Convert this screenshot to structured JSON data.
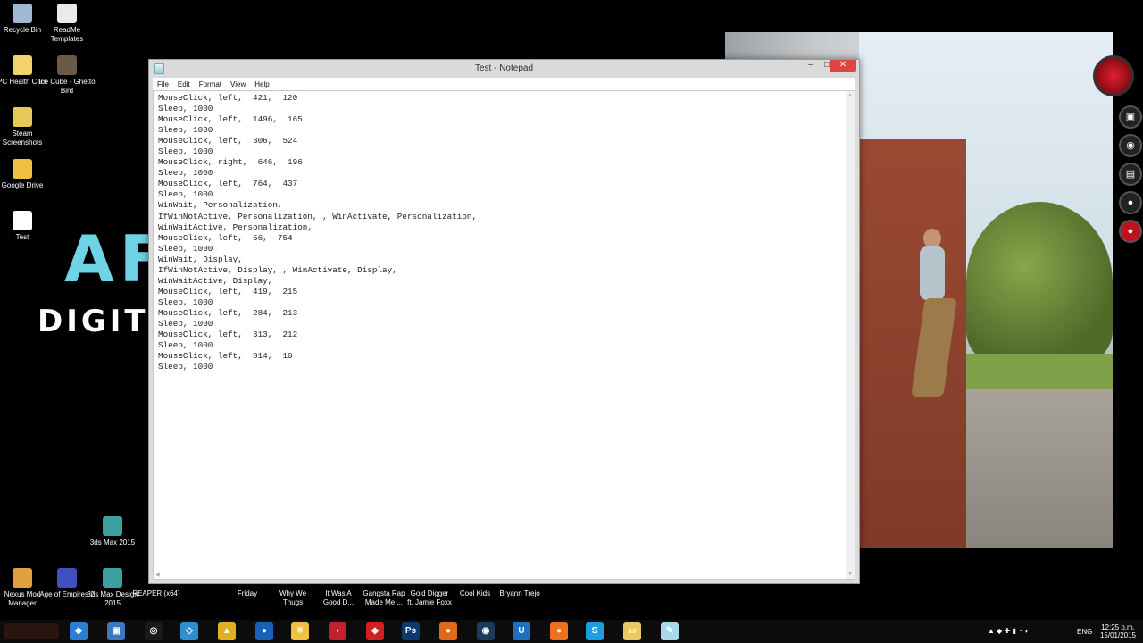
{
  "desktop_icons": [
    {
      "name": "recycle-bin",
      "label": "Recycle Bin",
      "color": "#9fb8d6"
    },
    {
      "name": "readme-templates",
      "label": "ReadMe Templates",
      "color": "#eaeaea"
    },
    {
      "name": "pc-health-care",
      "label": "PC Health Care",
      "color": "#f2d26a"
    },
    {
      "name": "ice-cube",
      "label": "Ice Cube - Ghetto Bird",
      "color": "#6b5a48"
    },
    {
      "name": "steam-screenshots",
      "label": "Steam Screenshots",
      "color": "#e8c85a"
    },
    {
      "name": "google-drive",
      "label": "Google Drive",
      "color": "#f0c040"
    },
    {
      "name": "test",
      "label": "Test",
      "color": "#ffffff"
    },
    {
      "name": "3ds-max-2015",
      "label": "3ds Max 2015",
      "color": "#3aa0a0"
    },
    {
      "name": "nexus-mod-manager",
      "label": "Nexus Mod Manager",
      "color": "#e0a040"
    },
    {
      "name": "age-of-empires-2",
      "label": "Age of Empires 2",
      "color": "#4050c0"
    },
    {
      "name": "3ds-max-design-2015",
      "label": "3ds Max Design 2015",
      "color": "#3aa0a0"
    }
  ],
  "bottom_labels": [
    "REAPER (x64)",
    "Friday",
    "Why We Thugs",
    "It Was A Good D...",
    "Gangsta Rap Made Me ...",
    "Gold Digger ft. Jamie Foxx",
    "Cool Kids",
    "Bryann Trejo"
  ],
  "wallpaper": {
    "title_fragment": "AF",
    "subtitle_fragment": "DIGIT"
  },
  "window": {
    "title": "Test - Notepad",
    "minimize": "–",
    "maximize": "□",
    "close": "✕",
    "menu": [
      "File",
      "Edit",
      "Format",
      "View",
      "Help"
    ],
    "content": "MouseClick, left,  421,  120\nSleep, 1000\nMouseClick, left,  1496,  165\nSleep, 1000\nMouseClick, left,  306,  524\nSleep, 1000\nMouseClick, right,  646,  196\nSleep, 1000\nMouseClick, left,  764,  437\nSleep, 1000\nWinWait, Personalization,\nIfWinNotActive, Personalization, , WinActivate, Personalization,\nWinWaitActive, Personalization,\nMouseClick, left,  56,  754\nSleep, 1000\nWinWait, Display,\nIfWinNotActive, Display, , WinActivate, Display,\nWinWaitActive, Display,\nMouseClick, left,  419,  215\nSleep, 1000\nMouseClick, left,  284,  213\nSleep, 1000\nMouseClick, left,  313,  212\nSleep, 1000\nMouseClick, left,  814,  10\nSleep, 1000"
  },
  "taskbar": {
    "apps": [
      {
        "name": "dropbox",
        "color": "#2a7fd4",
        "glyph": "◆"
      },
      {
        "name": "control-panel",
        "color": "#3a78c0",
        "glyph": "▣"
      },
      {
        "name": "origin-client",
        "color": "#1a1a1a",
        "glyph": "◎"
      },
      {
        "name": "sketch-app",
        "color": "#2e8fd0",
        "glyph": "◇"
      },
      {
        "name": "media-player",
        "color": "#e0b020",
        "glyph": "▲"
      },
      {
        "name": "browser-globe",
        "color": "#1860b8",
        "glyph": "●"
      },
      {
        "name": "pinwheel-app",
        "color": "#f0c040",
        "glyph": "✳"
      },
      {
        "name": "game-client",
        "color": "#c02030",
        "glyph": "◖"
      },
      {
        "name": "sketchup",
        "color": "#d02020",
        "glyph": "◆"
      },
      {
        "name": "photoshop",
        "color": "#0b3a6e",
        "glyph": "Ps"
      },
      {
        "name": "firefox",
        "color": "#e06a1a",
        "glyph": "●"
      },
      {
        "name": "steam",
        "color": "#1c3a5a",
        "glyph": "◉"
      },
      {
        "name": "uplay",
        "color": "#2070c0",
        "glyph": "U"
      },
      {
        "name": "origin",
        "color": "#f07020",
        "glyph": "●"
      },
      {
        "name": "skype",
        "color": "#1aa0e0",
        "glyph": "S"
      },
      {
        "name": "file-explorer",
        "color": "#e8c860",
        "glyph": "▭"
      },
      {
        "name": "notepad",
        "color": "#a8d8ec",
        "glyph": "✎"
      }
    ],
    "language": "ENG",
    "time": "12:25 p.m.",
    "date": "15/01/2015"
  }
}
